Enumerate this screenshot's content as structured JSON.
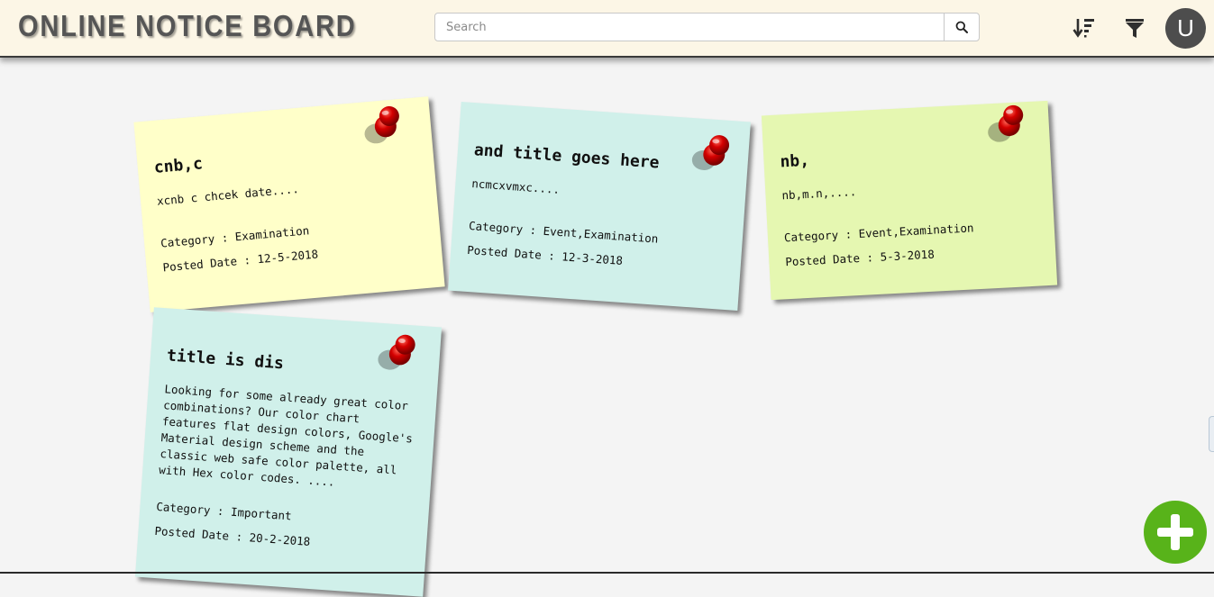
{
  "header": {
    "brand": "ONLINE NOTICE BOARD",
    "search_placeholder": "Search",
    "search_value": "",
    "user_initial": "U"
  },
  "toolbar": {
    "search_icon": "search-icon",
    "sort_icon": "sort-descending-icon",
    "filter_icon": "filter-icon"
  },
  "notices": [
    {
      "title": "cnb,c",
      "description": "xcnb c chcek date....",
      "category_label": "Category : Examination",
      "posted_label": "Posted Date : 12-5-2018",
      "color": "#ffffc9"
    },
    {
      "title": "and title goes here",
      "description": "ncmcxvmxc....",
      "category_label": "Category : Event,Examination",
      "posted_label": "Posted Date : 12-3-2018",
      "color": "#d0f0ea"
    },
    {
      "title": "nb,",
      "description": "nb,m.n,....",
      "category_label": "Category : Event,Examination",
      "posted_label": "Posted Date : 5-3-2018",
      "color": "#e5f7b1"
    },
    {
      "title": "title is dis",
      "description": "Looking for some already great color combinations? Our color chart features flat design colors, Google's Material design scheme and the classic web safe color palette, all with Hex color codes. ....",
      "category_label": "Category : Important",
      "posted_label": "Posted Date : 20-2-2018",
      "color": "#d0f0ea"
    }
  ],
  "colors": {
    "header_bg": "#fcf6e6",
    "page_bg": "#f4f4f4",
    "pin_red": "#cc0000",
    "fab_green": "#58b31a",
    "avatar_bg": "#4d4d4d"
  }
}
